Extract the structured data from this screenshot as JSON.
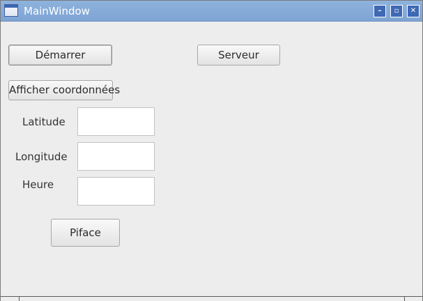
{
  "window": {
    "title": "MainWindow",
    "controls": {
      "minimize_icon": "minimize-icon",
      "maximize_icon": "maximize-icon",
      "close_icon": "close-icon",
      "minimize_glyph": "–",
      "maximize_glyph": "▫",
      "close_glyph": "✕"
    }
  },
  "buttons": {
    "start": "Démarrer",
    "server": "Serveur",
    "show_coordinates": "Afficher coordonnées",
    "piface": "Piface"
  },
  "fields": {
    "latitude": {
      "label": "Latitude",
      "value": ""
    },
    "longitude": {
      "label": "Longitude",
      "value": ""
    },
    "time": {
      "label": "Heure",
      "value": ""
    }
  },
  "colors": {
    "titlebar": "#7ea4d4",
    "window_background": "#ededed",
    "title_buttons": "#3f69b4"
  }
}
